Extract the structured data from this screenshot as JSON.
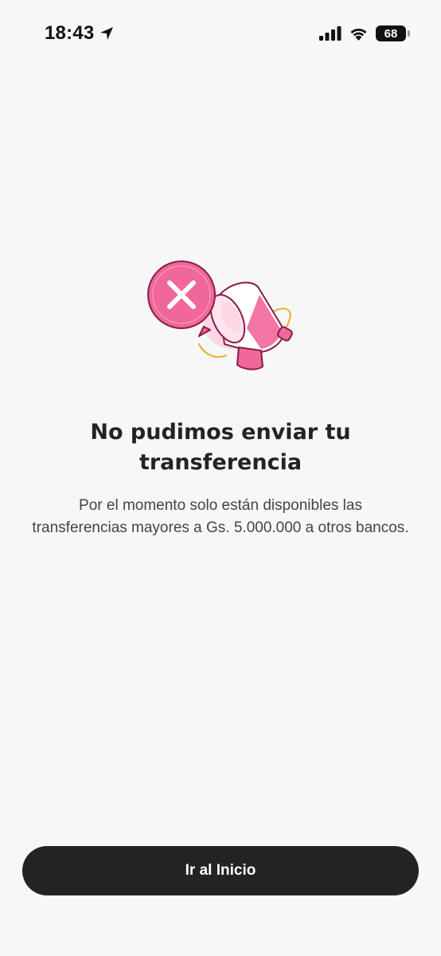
{
  "status_bar": {
    "time": "18:43",
    "battery_level": "68",
    "icons": [
      "location-arrow-icon",
      "cellular-signal-icon",
      "wifi-icon",
      "battery-icon"
    ]
  },
  "illustration": {
    "icon": "megaphone-error-icon",
    "colors": {
      "accent": "#f0679a",
      "accent_dark": "#c0245e",
      "light_pink": "#fbd7e5",
      "outline": "#8a1d45",
      "yellow": "#e8b53a"
    }
  },
  "error": {
    "title": "No pudimos enviar tu transferencia",
    "message": "Por el momento solo están disponibles las transferencias mayores a Gs. 5.000.000 a otros bancos."
  },
  "actions": {
    "home_button_label": "Ir al Inicio"
  },
  "colors": {
    "background": "#f7f7f7",
    "button_background": "#232326",
    "button_text": "#ffffff",
    "title_text": "#232323"
  }
}
